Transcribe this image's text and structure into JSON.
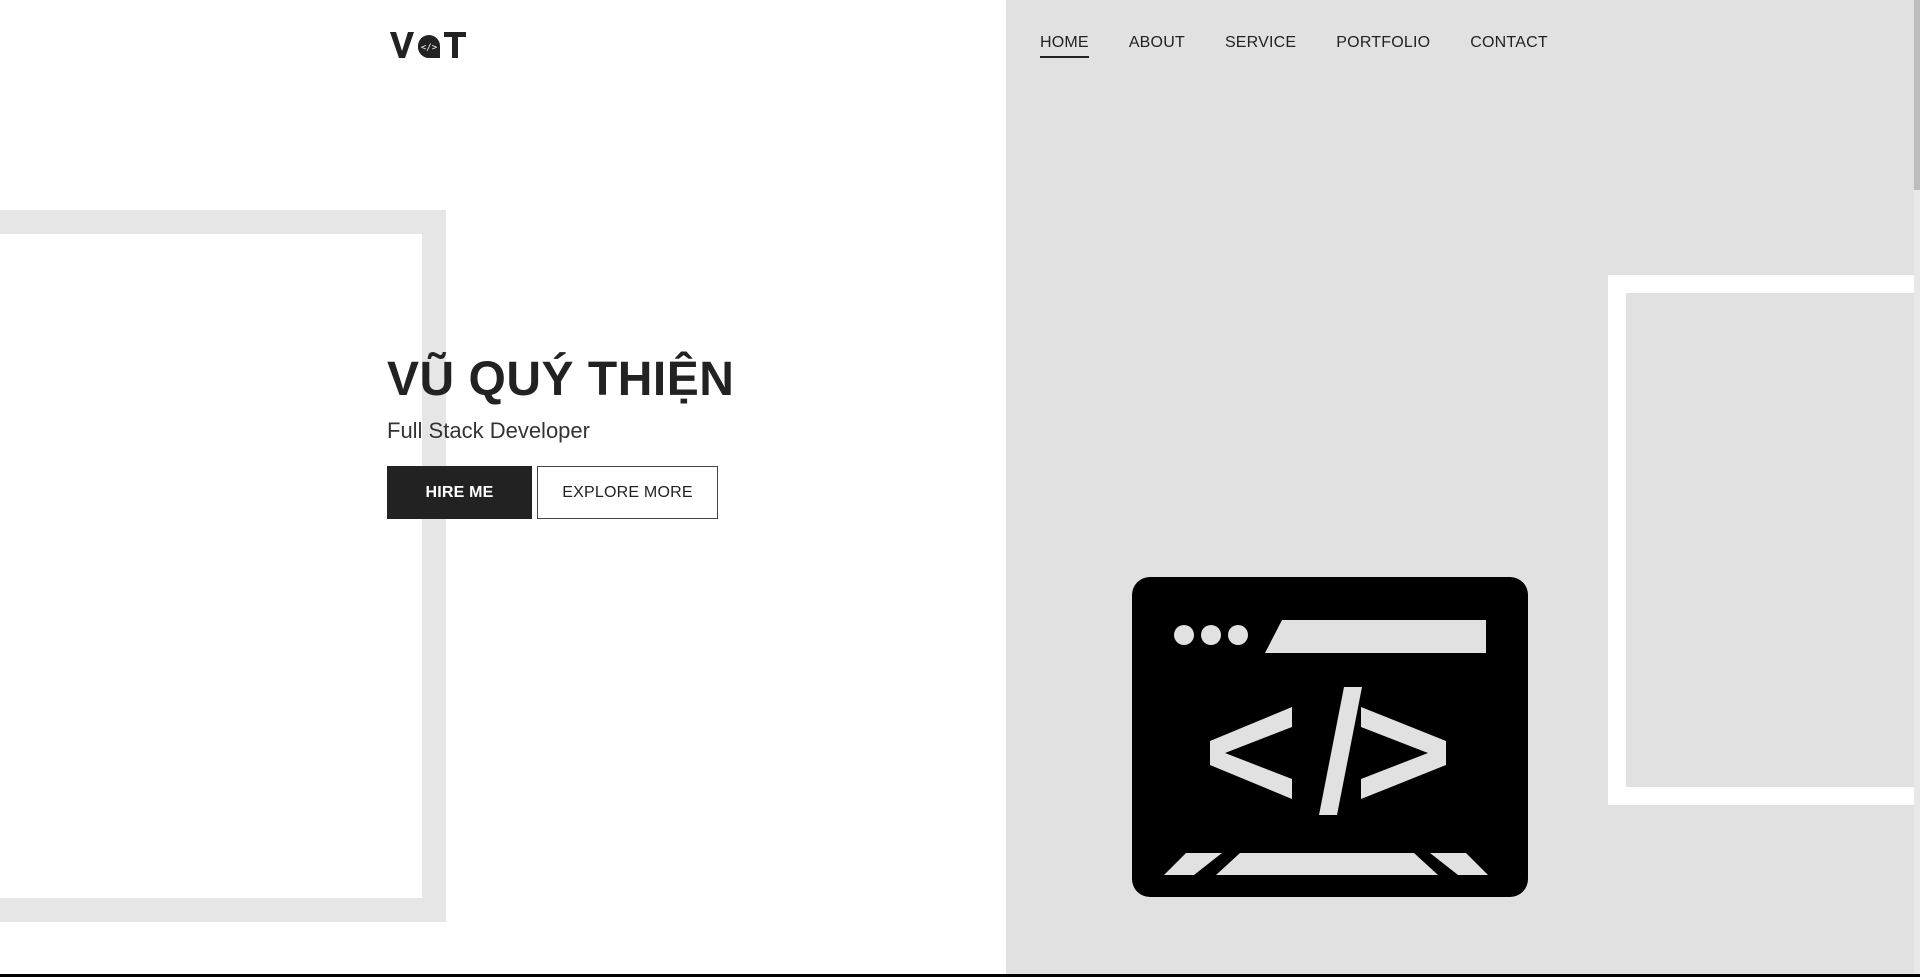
{
  "brand": {
    "logo_text": "VQT"
  },
  "nav": {
    "items": [
      {
        "label": "HOME",
        "active": true
      },
      {
        "label": "ABOUT",
        "active": false
      },
      {
        "label": "SERVICE",
        "active": false
      },
      {
        "label": "PORTFOLIO",
        "active": false
      },
      {
        "label": "CONTACT",
        "active": false
      }
    ]
  },
  "hero": {
    "name": "VŨ QUÝ THIỆN",
    "role": "Full Stack Developer",
    "primary_button": "HIRE ME",
    "secondary_button": "EXPLORE MORE"
  },
  "illustration": {
    "icon": "code-window-icon"
  },
  "colors": {
    "panel": "#e1e1e1",
    "dark": "#222222",
    "decor": "#e6e6e6"
  }
}
